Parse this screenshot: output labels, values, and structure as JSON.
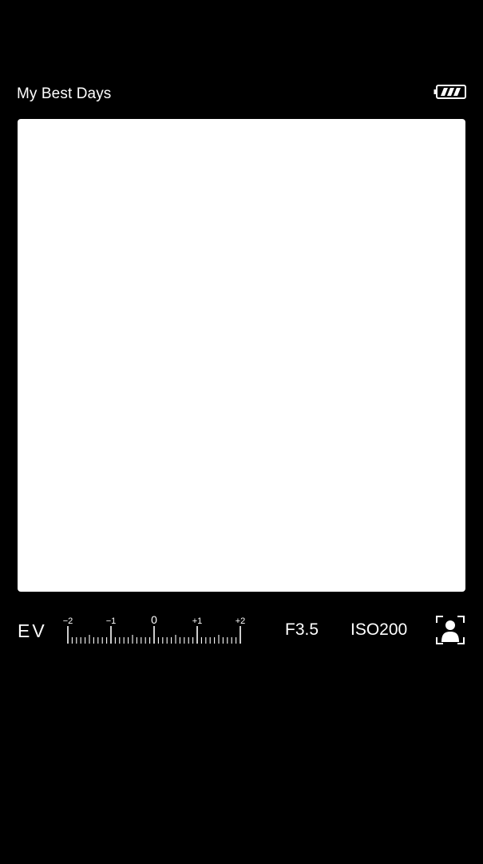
{
  "header": {
    "album_title": "My Best Days",
    "battery_icon": "battery-icon"
  },
  "viewfinder": {
    "fill_color": "#ffffff"
  },
  "exposure": {
    "label": "EV",
    "tick_labels": [
      "−2",
      "−1",
      "0",
      "+1",
      "+2"
    ],
    "value": 0
  },
  "settings": {
    "aperture": "F3.5",
    "iso": "ISO200",
    "face_mode_icon": "face-detection-icon"
  }
}
